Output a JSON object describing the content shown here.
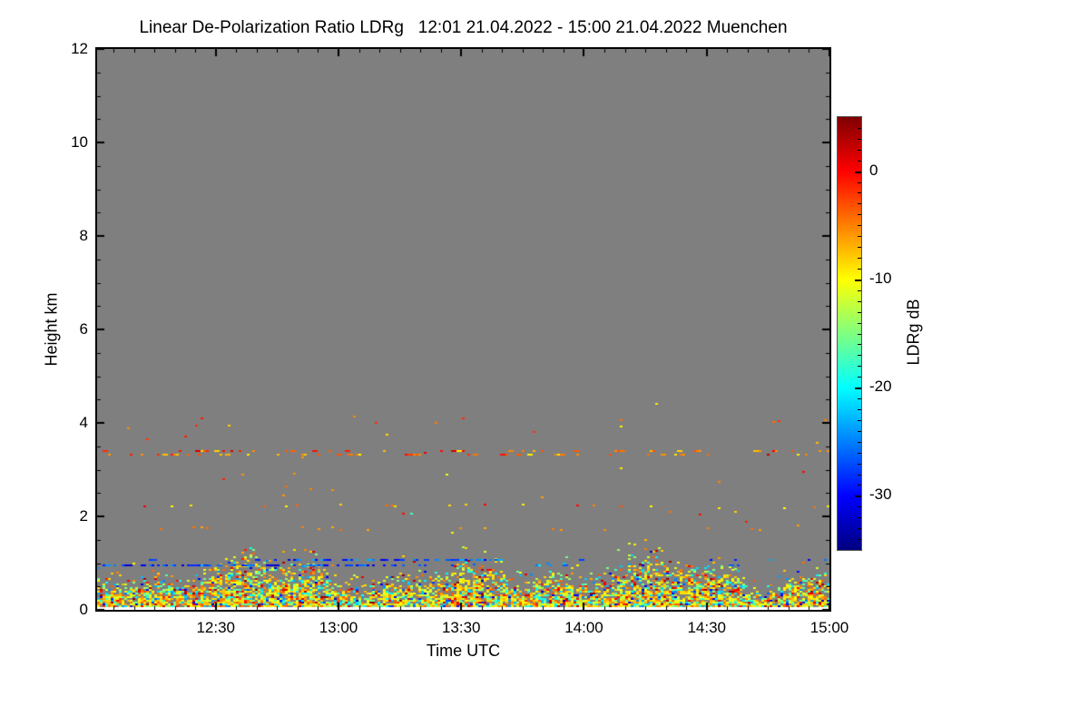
{
  "page": {
    "background": "#ffffff"
  },
  "chart_data": {
    "type": "heatmap",
    "title": "Linear De-Polarization Ratio LDRg   12:01 21.04.2022 - 15:00 21.04.2022 Muenchen",
    "xlabel": "Time UTC",
    "ylabel": "Height km",
    "x_start": "12:01",
    "x_end": "15:00",
    "x_total_minutes": 179,
    "x_ticks": [
      {
        "label": "12:30",
        "minute": 29
      },
      {
        "label": "13:00",
        "minute": 59
      },
      {
        "label": "13:30",
        "minute": 89
      },
      {
        "label": "14:00",
        "minute": 119
      },
      {
        "label": "14:30",
        "minute": 149
      },
      {
        "label": "15:00",
        "minute": 179
      }
    ],
    "x_minor_every_minutes": 5,
    "x_first_minor_minute": 4,
    "ylim": [
      0,
      12
    ],
    "y_ticks": [
      {
        "label": "0",
        "km": 0
      },
      {
        "label": "2",
        "km": 2
      },
      {
        "label": "4",
        "km": 4
      },
      {
        "label": "6",
        "km": 6
      },
      {
        "label": "8",
        "km": 8
      },
      {
        "label": "10",
        "km": 10
      },
      {
        "label": "12",
        "km": 12
      }
    ],
    "y_minor_step_km": 0.5,
    "plot_background": "#7f7f7f",
    "no_data_bottom_color": "#ffffff",
    "no_data_bottom_km": 0.055,
    "colorbar": {
      "label": "LDRg dB",
      "vmin": -35,
      "vmax": 5,
      "ticks": [
        {
          "label": "0",
          "value": 0
        },
        {
          "label": "-10",
          "value": -10
        },
        {
          "label": "-20",
          "value": -20
        },
        {
          "label": "-30",
          "value": -30
        }
      ],
      "minor_step_db": 1,
      "colormap": "jet",
      "gradient_stops": [
        {
          "pos": 0.0,
          "color": "#7f0000"
        },
        {
          "pos": 0.125,
          "color": "#ff0000"
        },
        {
          "pos": 0.375,
          "color": "#ffff00"
        },
        {
          "pos": 0.625,
          "color": "#00ffff"
        },
        {
          "pos": 0.875,
          "color": "#0000ff"
        },
        {
          "pos": 1.0,
          "color": "#00007f"
        }
      ]
    },
    "seed": 20220421,
    "features": {
      "boundary_layer": {
        "description": "dense flame-like aerosol speckle layer",
        "bottom_km": 0.06,
        "top_km_base": 0.78,
        "top_km_max": 1.48,
        "top_km_min": 0.35,
        "fill_density_bottom": 1.0,
        "fill_density_top": 0.1,
        "value_distribution": [
          {
            "weight": 0.4,
            "min_db": -12,
            "max_db": -7
          },
          {
            "weight": 0.16,
            "min_db": -7,
            "max_db": -3
          },
          {
            "weight": 0.12,
            "min_db": -16,
            "max_db": -12
          },
          {
            "weight": 0.12,
            "min_db": -21,
            "max_db": -16
          },
          {
            "weight": 0.07,
            "min_db": -25,
            "max_db": -21
          },
          {
            "weight": 0.06,
            "min_db": -2,
            "max_db": 2
          },
          {
            "weight": 0.04,
            "min_db": -33,
            "max_db": -26
          },
          {
            "weight": 0.03,
            "min_db": 2,
            "max_db": 4.5
          }
        ]
      },
      "blue_dash_lines": [
        {
          "km": 1.08,
          "x_frac_start": 0.2,
          "x_frac_end": 0.55,
          "density_in": 0.45,
          "density_out": 0.05,
          "min_db": -31,
          "max_db": -23
        },
        {
          "km": 0.97,
          "x_frac_start": 0.0,
          "x_frac_end": 0.42,
          "density_in": 0.5,
          "density_out": 0.07,
          "min_db": -32,
          "max_db": -24
        }
      ],
      "aerosol_line": {
        "description": "thin orange layer across whole record",
        "km_rows": [
          3.34,
          3.41
        ],
        "density": 0.32,
        "value_distribution": [
          {
            "weight": 0.55,
            "min_db": -6,
            "max_db": -3
          },
          {
            "weight": 0.17,
            "min_db": -10,
            "max_db": -7
          },
          {
            "weight": 0.16,
            "min_db": -2.5,
            "max_db": 0
          },
          {
            "weight": 0.12,
            "min_db": 0.5,
            "max_db": 3
          }
        ]
      },
      "sparse_rows": [
        {
          "km": 2.24,
          "density": 0.08,
          "value_distribution": [
            {
              "weight": 0.4,
              "min_db": -10,
              "max_db": -8
            },
            {
              "weight": 0.35,
              "min_db": -6,
              "max_db": -3
            },
            {
              "weight": 0.25,
              "min_db": -1.5,
              "max_db": 0.5
            }
          ]
        },
        {
          "km": 1.76,
          "density": 0.07,
          "value_distribution": [
            {
              "weight": 1.0,
              "min_db": -7,
              "max_db": -4
            }
          ]
        }
      ],
      "scattered_mid": {
        "km_min": 1.5,
        "km_max": 3.05,
        "density": 0.045,
        "value_distribution": [
          {
            "weight": 0.5,
            "min_db": -7,
            "max_db": -4
          },
          {
            "weight": 0.3,
            "min_db": -11,
            "max_db": -8
          },
          {
            "weight": 0.15,
            "min_db": -2,
            "max_db": 0
          },
          {
            "weight": 0.05,
            "min_db": -19,
            "max_db": -16
          }
        ]
      },
      "high_dots": {
        "count": 15,
        "km_min": 3.72,
        "km_max": 4.15,
        "extra": [
          {
            "km": 4.42,
            "x_frac": 0.765,
            "db": -9
          },
          {
            "km": 4.05,
            "x_frac": 0.93,
            "db": -2
          }
        ],
        "value_distribution": [
          {
            "weight": 0.45,
            "min_db": -2,
            "max_db": 0
          },
          {
            "weight": 0.35,
            "min_db": -6,
            "max_db": -3
          },
          {
            "weight": 0.2,
            "min_db": -10,
            "max_db": -8
          }
        ]
      }
    }
  }
}
